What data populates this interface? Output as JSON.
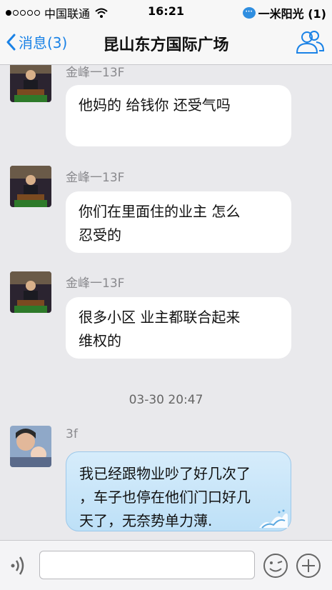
{
  "status_bar": {
    "carrier": "中国联通",
    "time": "16:21",
    "notification": "一米阳光 (1)"
  },
  "nav": {
    "back_label": "消息(3)",
    "title": "昆山东方国际广场"
  },
  "messages": [
    {
      "sender": "金峰一13F",
      "text_lines": [
        "他妈的  给钱你  还受气吗"
      ]
    },
    {
      "sender": "金峰一13F",
      "text_lines": [
        "你们在里面住的业主 怎么",
        "忍受的"
      ]
    },
    {
      "sender": "金峰一13F",
      "text_lines": [
        "很多小区  业主都联合起来",
        "维权的"
      ]
    },
    {
      "sender": "3f",
      "text_lines": [
        "我已经跟物业吵了好几次了",
        "，车子也停在他们门口好几",
        "天了，无奈势单力薄."
      ]
    }
  ],
  "timestamp": "03-30 20:47",
  "input": {
    "placeholder": ""
  },
  "icons": {
    "back": "chevron-left-icon",
    "contacts": "contacts-icon",
    "voice": "voice-icon",
    "emoji": "emoji-icon",
    "more": "plus-icon"
  },
  "colors": {
    "accent": "#1a82e6",
    "bubble_self": "#c7e4f8"
  }
}
